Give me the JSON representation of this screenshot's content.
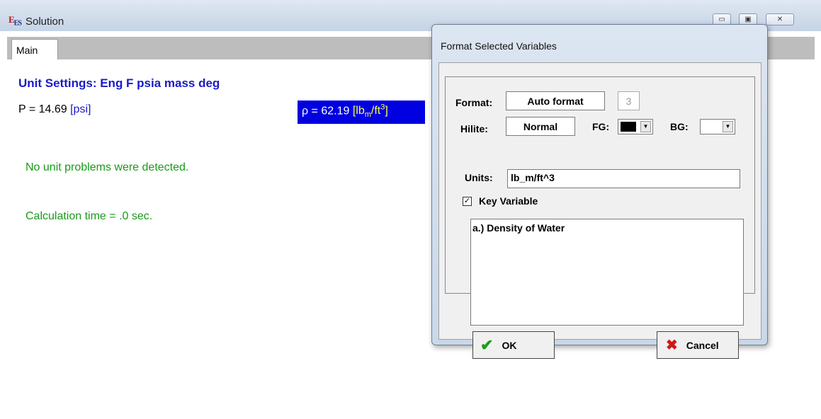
{
  "window": {
    "app_icon": "EES",
    "title": "Solution",
    "controls": {
      "minimize": "▭",
      "maximize": "▣",
      "close": "✕"
    }
  },
  "tabs": [
    {
      "label": "Main"
    }
  ],
  "main": {
    "unit_settings": "Unit Settings: Eng F psia mass deg",
    "p_value": "P  = 14.69",
    "p_unit": "[psi]",
    "rho_value": "ρ = 62.19",
    "rho_unit": "[lbm/ft3]",
    "msg_units": "No unit problems were detected.",
    "msg_time": "Calculation time = .0 sec."
  },
  "dialog": {
    "title": "Format Selected Variables",
    "format_label": "Format:",
    "format_value": "Auto format",
    "digits": "3",
    "hilite_label": "Hilite:",
    "hilite_value": "Normal",
    "fg_label": "FG:",
    "fg_color": "#000000",
    "bg_label": "BG:",
    "bg_color": "#ffffff",
    "units_label": "Units:",
    "units_value": "lb_m/ft^3",
    "key_variable_label": "Key Variable",
    "key_variable_checked": true,
    "description": "a.)  Density of Water",
    "ok_label": "OK",
    "cancel_label": "Cancel"
  }
}
